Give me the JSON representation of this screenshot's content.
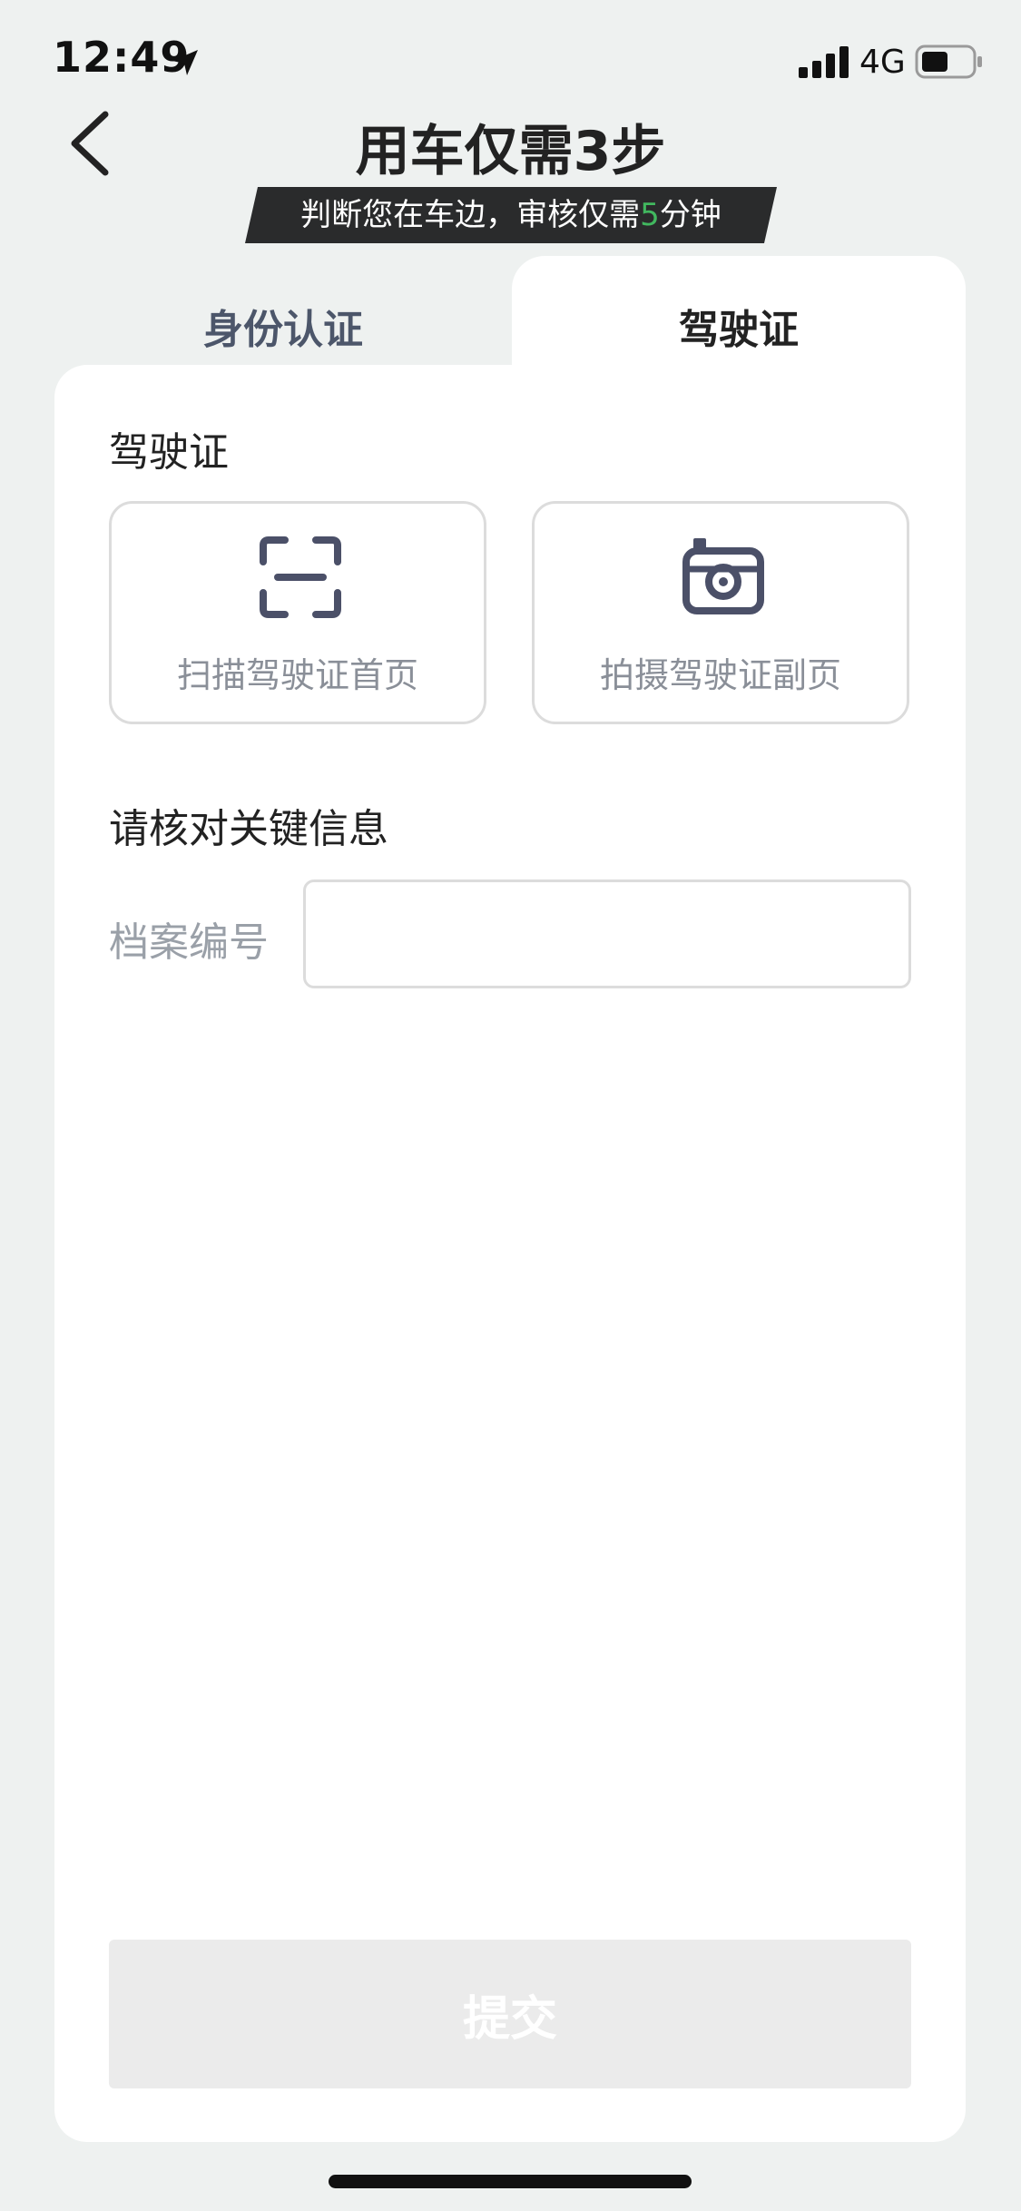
{
  "status_bar": {
    "time": "12:49",
    "network": "4G"
  },
  "header": {
    "title": "用车仅需3步",
    "banner": {
      "text_before": "判断您在车边，审核仅需",
      "highlight": "5",
      "text_after": "分钟",
      "highlight_color": "#41b85f"
    }
  },
  "tabs": [
    {
      "label": "身份认证",
      "active": false
    },
    {
      "label": "驾驶证",
      "active": true
    }
  ],
  "license_section": {
    "title": "驾驶证",
    "scan_front_label": "扫描驾驶证首页",
    "scan_front_icon": "scan-icon",
    "photo_back_label": "拍摄驾驶证副页",
    "photo_back_icon": "camera-icon"
  },
  "verify_section": {
    "title": "请核对关键信息",
    "file_number_label": "档案编号",
    "file_number_value": ""
  },
  "submit_label": "提交"
}
